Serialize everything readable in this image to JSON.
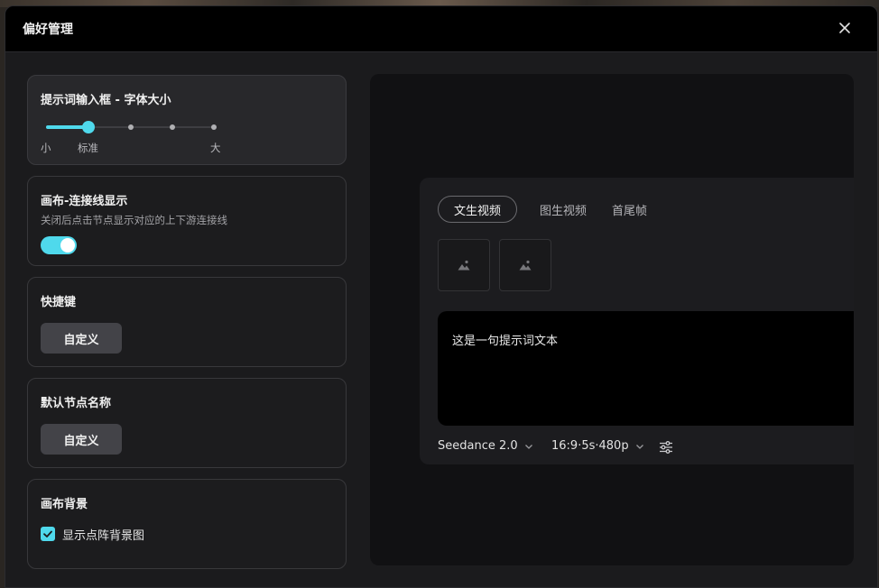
{
  "modal": {
    "title": "偏好管理",
    "close_icon": "close-icon"
  },
  "colors": {
    "accent": "#4fd9ec",
    "panel_bg": "#1b1b1d",
    "header_bg": "#000000",
    "button_bg": "#434348"
  },
  "font_size_card": {
    "title": "提示词输入框 - 字体大小",
    "labels": [
      "小",
      "标准",
      "大"
    ],
    "steps": 5,
    "selected_step": 2,
    "selected_label": "标准"
  },
  "connector_card": {
    "title": "画布-连接线显示",
    "description": "关闭后点击节点显示对应的上下游连接线",
    "toggle_on": true
  },
  "shortcut_card": {
    "title": "快捷键",
    "button_label": "自定义"
  },
  "node_name_card": {
    "title": "默认节点名称",
    "button_label": "自定义"
  },
  "canvas_bg_card": {
    "title": "画布背景",
    "checkbox_label": "显示点阵背景图",
    "checked": true
  },
  "preview": {
    "tabs": [
      {
        "label": "文生视频",
        "active": true
      },
      {
        "label": "图生视频",
        "active": false
      },
      {
        "label": "首尾帧",
        "active": false
      }
    ],
    "image_slot_icon": "image-placeholder-icon",
    "prompt_text": "这是一句提示词文本",
    "model": "Seedance 2.0",
    "params": "16:9·5s·480p",
    "settings_icon": "sliders-icon"
  }
}
